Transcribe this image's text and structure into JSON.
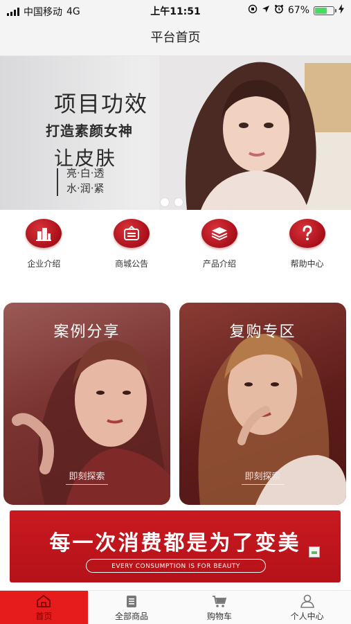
{
  "status_bar": {
    "carrier": "中国移动",
    "network": "4G",
    "time": "上午11:51",
    "battery_percent": "67%",
    "battery_level": 0.67
  },
  "nav": {
    "title": "平台首页"
  },
  "banner": {
    "title": "项目功效",
    "subtitle": "打造素颜女神",
    "headline": "让皮肤",
    "words_line1": "亮·白·透",
    "words_line2": "水·润·紧",
    "slide_count": 2
  },
  "menu": {
    "items": [
      {
        "label": "企业介绍",
        "icon": "building-icon"
      },
      {
        "label": "商城公告",
        "icon": "notice-icon"
      },
      {
        "label": "产品介绍",
        "icon": "layers-icon"
      },
      {
        "label": "帮助中心",
        "icon": "help-icon"
      }
    ],
    "accent_color": "#b8121c"
  },
  "cards": {
    "left": {
      "title": "案例分享",
      "button": "即刻探索"
    },
    "right": {
      "title": "复购专区",
      "button": "即刻探索"
    }
  },
  "slogan": {
    "text": "每一次消费都是为了变美",
    "english": "EVERY CONSUMPTION IS FOR BEAUTY",
    "color": "#c4161d"
  },
  "tabbar": {
    "active_color": "#e61c1c",
    "items": [
      {
        "label": "首页",
        "icon": "home-icon",
        "active": true
      },
      {
        "label": "全部商品",
        "icon": "document-icon",
        "active": false
      },
      {
        "label": "购物车",
        "icon": "cart-icon",
        "active": false
      },
      {
        "label": "个人中心",
        "icon": "user-icon",
        "active": false
      }
    ]
  }
}
